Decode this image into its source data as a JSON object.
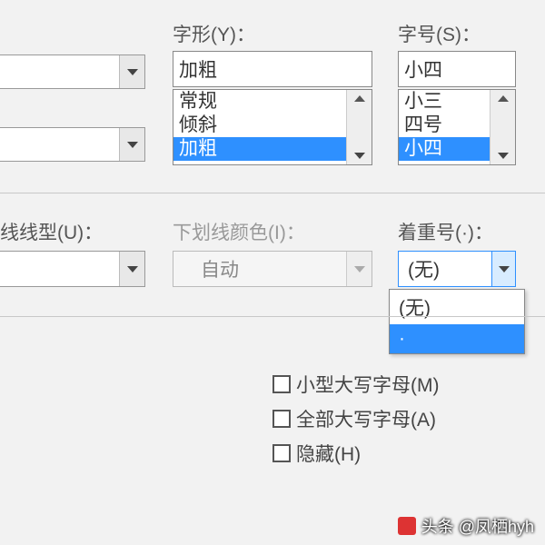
{
  "style": {
    "label": "字形(Y)：",
    "value": "加粗",
    "options": [
      "常规",
      "倾斜",
      "加粗"
    ],
    "selected_index": 2
  },
  "size": {
    "label": "字号(S)：",
    "value": "小四",
    "options": [
      "小三",
      "四号",
      "小四"
    ],
    "selected_index": 2
  },
  "underline_type": {
    "label": "线线型(U)："
  },
  "underline_color": {
    "label": "下划线颜色(I)：",
    "value": "自动"
  },
  "emphasis": {
    "label": "着重号(·)：",
    "value": "(无)",
    "menu": [
      "(无)",
      "·"
    ],
    "highlight_index": 1
  },
  "checks": {
    "small_caps": "小型大写字母(M)",
    "all_caps": "全部大写字母(A)",
    "hidden": "隐藏(H)"
  },
  "watermark": "头条 @凤栖hyh"
}
